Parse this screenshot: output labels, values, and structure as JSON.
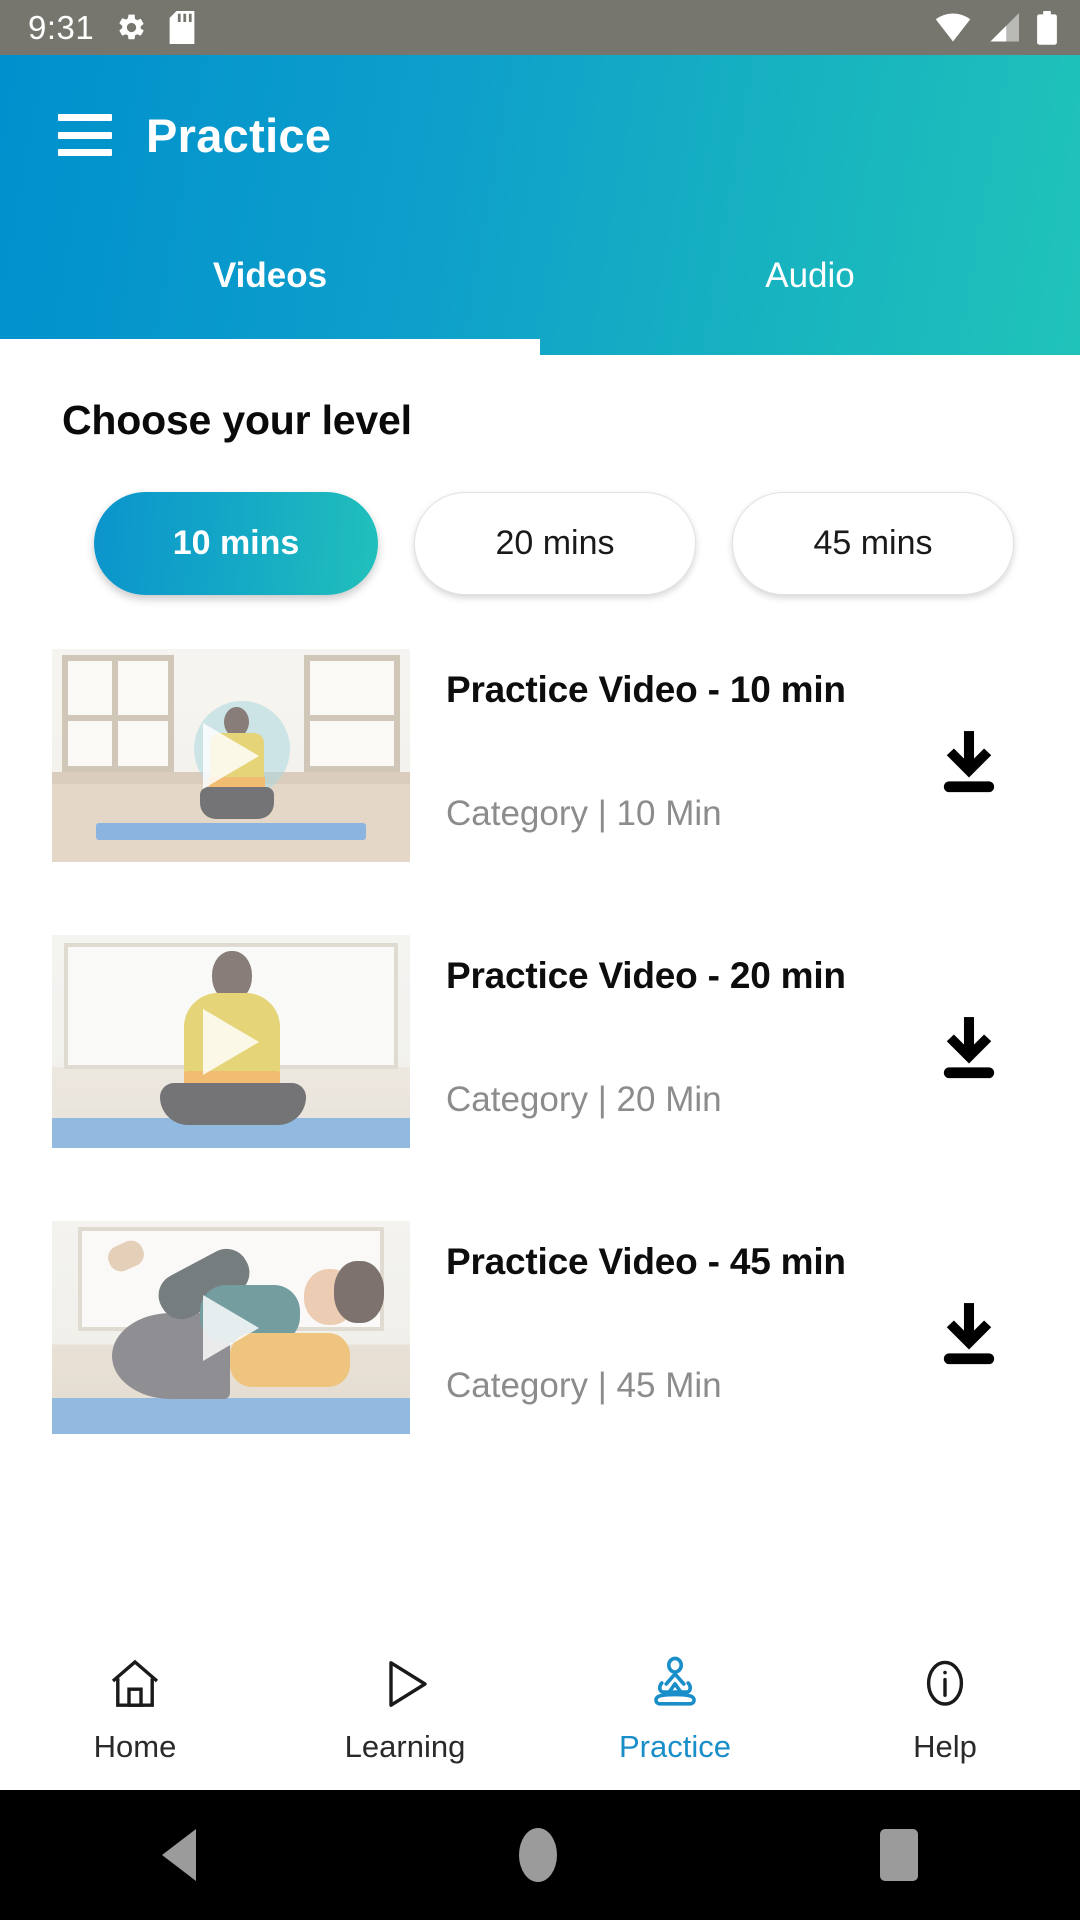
{
  "status_bar": {
    "time": "9:31",
    "icons_left": [
      "gear-icon",
      "sd-card-icon"
    ],
    "icons_right": [
      "wifi-icon",
      "signal-icon",
      "battery-icon"
    ],
    "background": "#76766f"
  },
  "app_bar": {
    "menu_icon": "hamburger-menu-icon",
    "title": "Practice",
    "gradient_start": "#0090cd",
    "gradient_end": "#20c3b9",
    "tabs": [
      {
        "label": "Videos",
        "active": true
      },
      {
        "label": "Audio",
        "active": false
      }
    ]
  },
  "main": {
    "section_title": "Choose your level",
    "level_filters": [
      {
        "label": "10 mins",
        "active": true
      },
      {
        "label": "20 mins",
        "active": false
      },
      {
        "label": "45 mins",
        "active": false
      }
    ],
    "videos": [
      {
        "title": "Practice Video - 10 min",
        "subtitle": "Category | 10 Min",
        "play_icon": "play-icon",
        "download_icon": "download-icon"
      },
      {
        "title": "Practice Video - 20 min",
        "subtitle": "Category | 20 Min",
        "play_icon": "play-icon",
        "download_icon": "download-icon"
      },
      {
        "title": "Practice Video - 45 min",
        "subtitle": "Category | 45 Min",
        "play_icon": "play-icon",
        "download_icon": "download-icon"
      }
    ]
  },
  "bottom_nav": {
    "active_color": "#1a8ec9",
    "items": [
      {
        "label": "Home",
        "icon": "home-icon",
        "active": false
      },
      {
        "label": "Learning",
        "icon": "play-outline-icon",
        "active": false
      },
      {
        "label": "Practice",
        "icon": "meditation-icon",
        "active": true
      },
      {
        "label": "Help",
        "icon": "info-circle-icon",
        "active": false
      }
    ]
  },
  "android_nav": {
    "items": [
      "back-icon",
      "home-icon",
      "recents-icon"
    ]
  }
}
